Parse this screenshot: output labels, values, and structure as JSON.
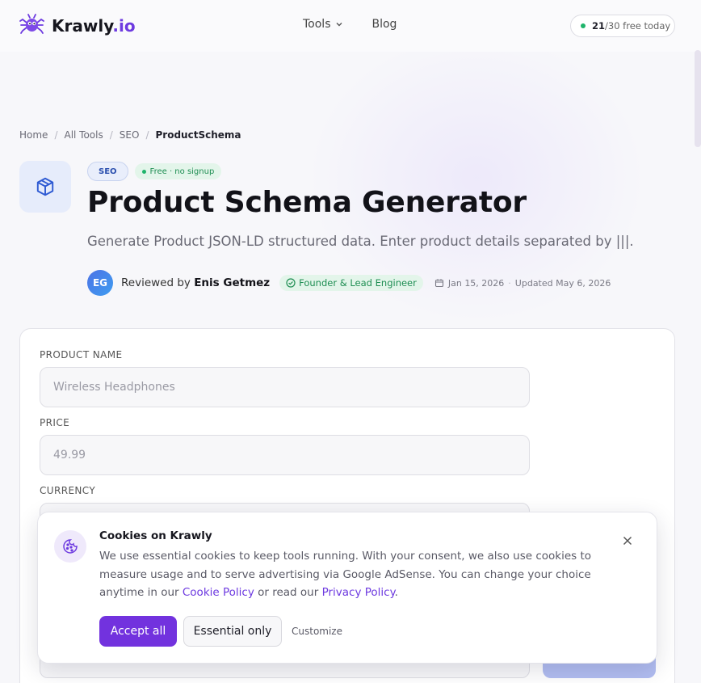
{
  "header": {
    "logo_name": "Krawly",
    "logo_tld": ".io",
    "nav": [
      {
        "label": "Tools",
        "icon": "chevron-down-icon"
      },
      {
        "label": "Blog"
      }
    ],
    "counter": {
      "used": "21",
      "rest": "/30 free today"
    }
  },
  "breadcrumb": {
    "items": [
      "Home",
      "All Tools",
      "SEO"
    ],
    "separator": "/",
    "current": "ProductSchema"
  },
  "hero": {
    "icon": "cube-icon",
    "category_badge": "SEO",
    "free_badge": "Free · no signup",
    "title": "Product Schema Generator",
    "subtitle": "Generate Product JSON-LD structured data. Enter product details separated by |||.",
    "reviewer": {
      "initials": "EG",
      "prefix": "Reviewed by ",
      "name": "Enis Getmez",
      "role": "Founder & Lead Engineer",
      "published": "Jan 15, 2026",
      "separator": "·",
      "updated": "Updated May 6, 2026"
    }
  },
  "form": {
    "fields": [
      {
        "label": "PRODUCT NAME",
        "placeholder": "Wireless Headphones",
        "value": ""
      },
      {
        "label": "PRICE",
        "placeholder": "49.99",
        "value": ""
      },
      {
        "label": "CURRENCY",
        "placeholder": "",
        "value": ""
      }
    ]
  },
  "cookie": {
    "icon": "cookie-icon",
    "title": "Cookies on Krawly",
    "text_before": "We use essential cookies to keep tools running. With your consent, we also use cookies to measure usage and to serve advertising via Google AdSense. You can change your choice anytime in our ",
    "cookie_link": "Cookie Policy",
    "text_mid": " or read our ",
    "privacy_link": "Privacy Policy",
    "text_end": ".",
    "accept_label": "Accept all",
    "essential_label": "Essential only",
    "customize_label": "Customize"
  },
  "colors": {
    "brand": "#6d3ae0",
    "accept": "#7232de",
    "success": "#1fb46b",
    "seo_badge": "#2b4fae"
  }
}
